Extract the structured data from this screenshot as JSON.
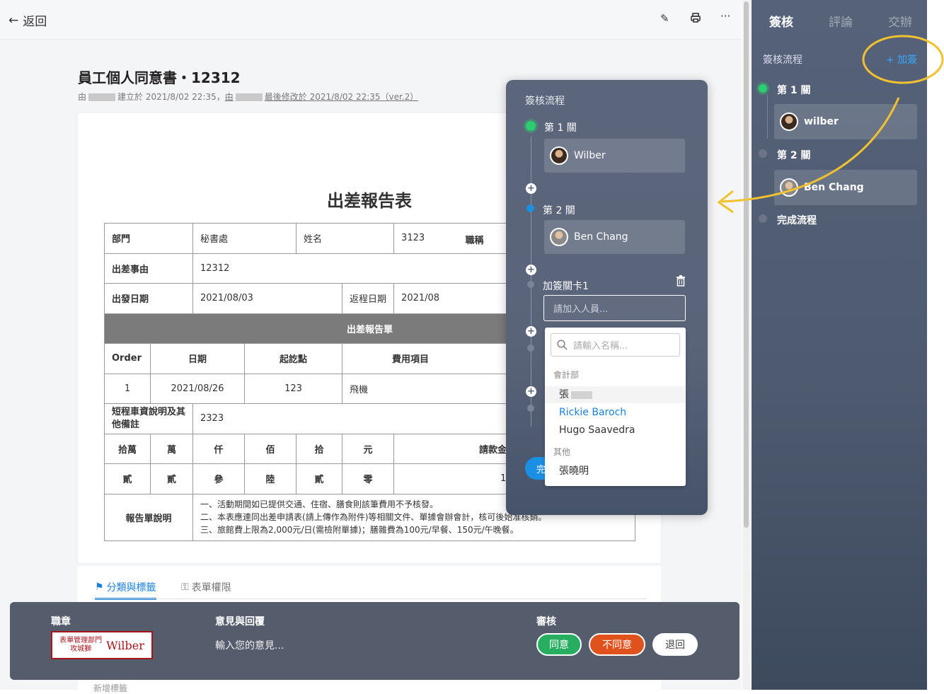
{
  "topbar": {
    "back_label": "返回",
    "edit_icon": "pencil-icon",
    "print_icon": "printer-icon",
    "more_icon": "more-icon"
  },
  "doc": {
    "title": "員工個人同意書・12312",
    "meta_by": "由",
    "meta_created": "建立於 2021/8/02 22:35，",
    "meta_by2": "由",
    "meta_modified": "最後修改於 2021/8/02 22:35（ver.2）"
  },
  "form": {
    "title": "出差報告表",
    "dept_label": "部門",
    "dept_value": "秘書處",
    "name_label": "姓名",
    "name_value": "3123",
    "title_label": "職稱",
    "reason_label": "出差事由",
    "reason_value": "12312",
    "depart_label": "出發日期",
    "depart_value": "2021/08/03",
    "return_label": "返程日期",
    "return_value": "2021/08",
    "report_band": "出差報告單",
    "col_order": "Order",
    "col_date": "日期",
    "col_route": "起訖點",
    "col_item": "費用項目",
    "row_order": "1",
    "row_date": "2021/08/26",
    "row_route": "123",
    "row_item": "飛機",
    "note_label": "短程車資說明及其他備註",
    "note_value": "2323",
    "amt_headers": [
      "拾萬",
      "萬",
      "仟",
      "佰",
      "拾",
      "元"
    ],
    "amt_request_label": "請款金",
    "amt_values": [
      "貳",
      "貳",
      "參",
      "陸",
      "貳",
      "零"
    ],
    "amt_total": "1",
    "remark_label": "報告單說明",
    "remark_lines": [
      "一、活動期間如已提供交通、住宿、膳食則該筆費用不予核發。",
      "二、本表應連同出差申請表(請上傳作為附件)等相關文件、單據會辦會計，核可後始准核銷。",
      "三、旅館費上限為2,000元/日(需檢附單據)；膳雜費為100元/早餐、150元/午晚餐。"
    ]
  },
  "tabs": {
    "category": "分類與標籤",
    "permission": "表單權限",
    "new_tag": "新增標籤"
  },
  "bottom": {
    "seal_label": "職章",
    "seal_dept": "表單管理部門",
    "seal_title": "攻城獅",
    "seal_name": "Wilber",
    "opinion_label": "意見與回覆",
    "opinion_placeholder": "輸入您的意見...",
    "review_label": "審核",
    "agree": "同意",
    "disagree": "不同意",
    "return": "退回"
  },
  "sidebar": {
    "tabs": [
      "簽核",
      "評論",
      "交辦"
    ],
    "flow_label": "簽核流程",
    "add_sign": "+ 加簽",
    "step1": "第 1 關",
    "step1_user": "wilber",
    "step2": "第 2 關",
    "step2_user": "Ben Chang",
    "done": "完成流程"
  },
  "modal": {
    "title": "簽核流程",
    "step1": "第 1 關",
    "step1_user": "Wilber",
    "step2": "第 2 關",
    "step2_user": "Ben Chang",
    "added_step": "加簽關卡1",
    "input_placeholder": "請加入人員...",
    "done_partial": "完",
    "dropdown": {
      "search_placeholder": "請輸入名稱...",
      "group1": "會計部",
      "item_blurred": "張",
      "item_selected": "Rickie Baroch",
      "item3": "Hugo Saavedra",
      "group2": "其他",
      "item4": "張曉明"
    }
  },
  "colors": {
    "accent_blue": "#1a7fd8",
    "agree_green": "#27ae60",
    "disagree_orange": "#e0521c",
    "sidebar": "#566279",
    "arrow": "#f2c12e"
  }
}
